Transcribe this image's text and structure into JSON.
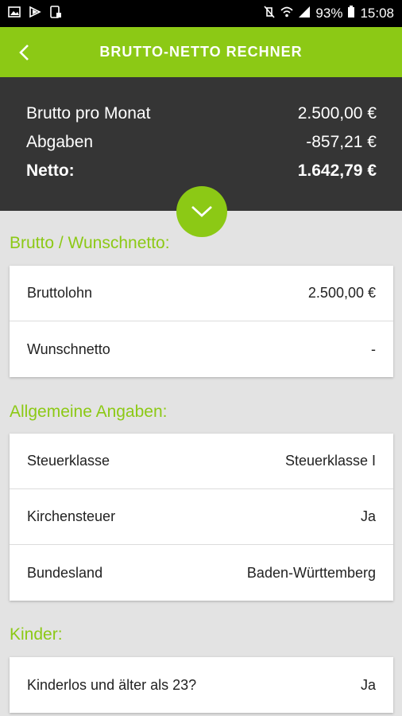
{
  "status_bar": {
    "left_icons": [
      "image-icon",
      "play-store-icon",
      "screenshot-icon"
    ],
    "right_icons": [
      "mute-vibrate-icon",
      "wifi-icon",
      "signal-icon",
      "battery-icon"
    ],
    "battery": "93%",
    "time": "15:08"
  },
  "appbar": {
    "title": "BRUTTO-NETTO RECHNER",
    "background": "#8cc915"
  },
  "summary": {
    "rows": [
      {
        "label": "Brutto pro Monat",
        "value": "2.500,00 €"
      },
      {
        "label": "Abgaben",
        "value": "-857,21 €"
      },
      {
        "label": "Netto:",
        "value": "1.642,79 €"
      }
    ],
    "background": "#353535"
  },
  "sections": [
    {
      "title": "Brutto / Wunschnetto:",
      "rows": [
        {
          "label": "Bruttolohn",
          "value": "2.500,00 €"
        },
        {
          "label": "Wunschnetto",
          "value": "-"
        }
      ]
    },
    {
      "title": "Allgemeine Angaben:",
      "rows": [
        {
          "label": "Steuerklasse",
          "value": "Steuerklasse I"
        },
        {
          "label": "Kirchensteuer",
          "value": "Ja"
        },
        {
          "label": "Bundesland",
          "value": "Baden-Württemberg"
        }
      ]
    },
    {
      "title": "Kinder:",
      "rows": [
        {
          "label": "Kinderlos und älter als 23?",
          "value": "Ja"
        }
      ]
    }
  ],
  "colors": {
    "accent": "#8cc915",
    "dark": "#353535",
    "page_bg": "#e3e3e3"
  }
}
